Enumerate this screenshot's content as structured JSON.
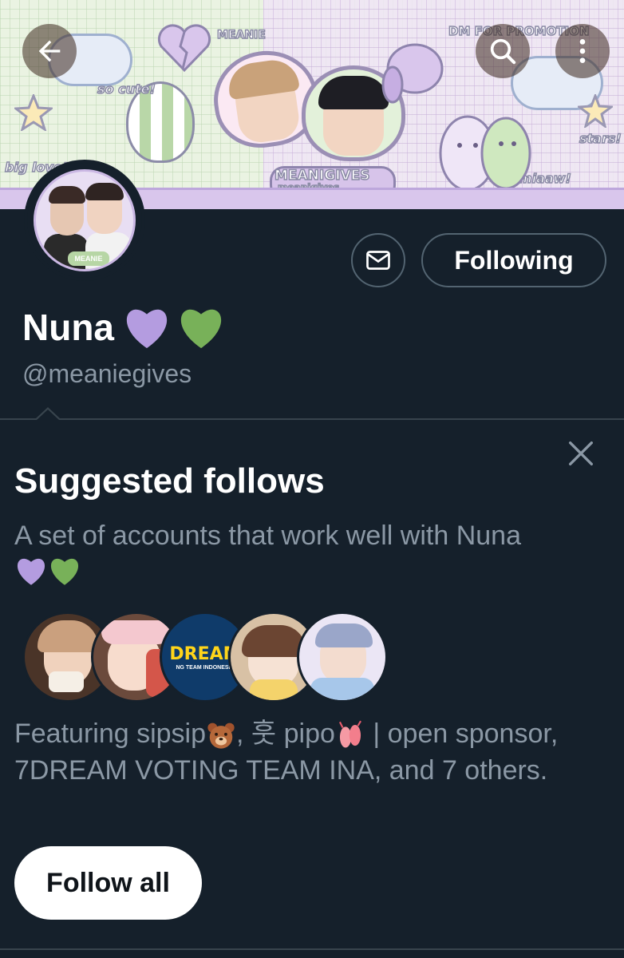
{
  "banner": {
    "stickers": [
      "so cute!",
      "MEANIE",
      "DM FOR PROMOTION",
      "big love!",
      "MEANIGIVES",
      "meanigives",
      "stars!",
      "miaaw!"
    ]
  },
  "profile": {
    "display_name": "Nuna",
    "handle": "@meaniegives",
    "avatar_tag": "MEANIE",
    "following_label": "Following"
  },
  "suggested": {
    "title": "Suggested follows",
    "description": "A set of accounts that work well with Nuna",
    "featuring_part1": "Featuring sipsip",
    "featuring_part2": ", 훗 pipo",
    "featuring_part3": " | open sponsor, 7DREAM VOTING TEAM INA, and 7 others.",
    "dream_logo_text": "DREAM",
    "dream_logo_sub": "NG TEAM INDONESIA",
    "follow_all_label": "Follow all"
  },
  "colors": {
    "background": "#15202b",
    "secondary_text": "#8b98a5",
    "border": "#536471",
    "purple_heart": "#b49ce0",
    "green_heart": "#78b159"
  },
  "icons": [
    "back-arrow-icon",
    "search-icon",
    "more-vertical-icon",
    "mail-icon",
    "close-icon",
    "purple-heart-icon",
    "green-heart-icon",
    "bear-icon",
    "ballet-shoes-icon"
  ]
}
